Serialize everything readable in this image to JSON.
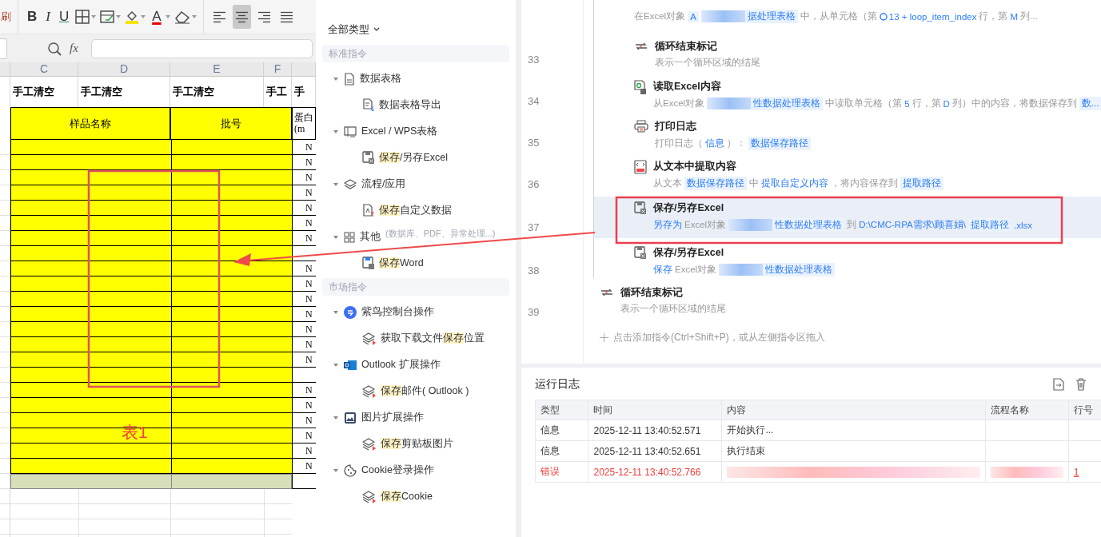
{
  "spreadsheet": {
    "toolbar": {
      "cut_label": "刷",
      "format_buttons": [
        "B",
        "I",
        "U"
      ],
      "font_color_label": "A",
      "align_buttons": [
        {
          "selected": false
        },
        {
          "selected": true
        },
        {
          "selected": false
        },
        {
          "selected": false
        }
      ]
    },
    "formula_label": "fx",
    "column_headers": [
      "C",
      "D",
      "E",
      "F"
    ],
    "header_row": [
      "手工清空",
      "手工清空",
      "手工清空",
      "手工",
      "手"
    ],
    "title_row": {
      "sample": "样品名称",
      "batch": "批号",
      "protein": "蛋白",
      "unit": "(m"
    },
    "rows": [
      {
        "column_g": "N"
      },
      {
        "column_g": "N"
      },
      {
        "column_g": "N"
      },
      {
        "column_g": "N"
      },
      {
        "column_g": "N"
      },
      {
        "column_g": "N"
      },
      {
        "column_g": "N"
      },
      {},
      {
        "column_g": "N"
      },
      {
        "column_g": "N"
      },
      {
        "column_g": "N"
      },
      {
        "column_g": "N"
      },
      {
        "column_g": "N"
      },
      {
        "column_g": "N"
      },
      {
        "column_g": "N"
      },
      {},
      {
        "column_g": "N"
      },
      {
        "column_g": "N"
      },
      {
        "column_g": "N"
      },
      {
        "column_g": "N"
      },
      {
        "column_g": "N"
      },
      {
        "column_g": "N"
      }
    ],
    "annotation_label": "表1"
  },
  "commands": {
    "filter": "全部类型",
    "sections": [
      {
        "title": "标准指令",
        "groups": [
          {
            "label": "数据表格",
            "expanded": true,
            "items": [
              {
                "parts": [
                  {
                    "text": "数据表格导出",
                    "highlight": false
                  }
                ]
              }
            ]
          },
          {
            "label": "Excel / WPS表格",
            "expanded": true,
            "items": [
              {
                "parts": [
                  {
                    "text": "保存",
                    "highlight": true
                  },
                  {
                    "text": "/另存Excel",
                    "highlight": false
                  }
                ]
              }
            ]
          },
          {
            "label": "流程/应用",
            "expanded": true,
            "items": [
              {
                "parts": [
                  {
                    "text": "保存",
                    "highlight": true
                  },
                  {
                    "text": "自定义数据",
                    "highlight": false
                  }
                ]
              }
            ]
          },
          {
            "label": "其他",
            "note": "(数据库、PDF、异常处理...)",
            "expanded": true,
            "items": [
              {
                "parts": [
                  {
                    "text": "保存",
                    "highlight": true
                  },
                  {
                    "text": "Word",
                    "highlight": false
                  }
                ]
              }
            ]
          }
        ]
      },
      {
        "title": "市场指令",
        "groups": [
          {
            "label": "紫鸟控制台操作",
            "expanded": true,
            "items": [
              {
                "parts": [
                  {
                    "text": "获取下载文件",
                    "highlight": false
                  },
                  {
                    "text": "保存",
                    "highlight": true
                  },
                  {
                    "text": "位置",
                    "highlight": false
                  }
                ]
              }
            ]
          },
          {
            "label": "Outlook 扩展操作",
            "expanded": true,
            "items": [
              {
                "parts": [
                  {
                    "text": "保存",
                    "highlight": true
                  },
                  {
                    "text": "邮件( Outlook )",
                    "highlight": false
                  }
                ]
              }
            ]
          },
          {
            "label": "图片扩展操作",
            "expanded": true,
            "items": [
              {
                "parts": [
                  {
                    "text": "保存",
                    "highlight": true
                  },
                  {
                    "text": "剪贴板图片",
                    "highlight": false
                  }
                ]
              }
            ]
          },
          {
            "label": "Cookie登录操作",
            "expanded": true,
            "items": [
              {
                "parts": [
                  {
                    "text": "保存",
                    "highlight": true
                  },
                  {
                    "text": "Cookie",
                    "highlight": false
                  }
                ]
              }
            ]
          }
        ]
      }
    ]
  },
  "flow": {
    "items": [
      {
        "kind": "loop-body",
        "children": [
          {
            "kind": "partial",
            "selected": false,
            "segments": [
              {
                "kind": "text",
                "text": "在Excel对象"
              },
              {
                "kind": "token",
                "text": "A"
              },
              {
                "kind": "redacted"
              },
              {
                "kind": "token",
                "text": "据处理表格"
              },
              {
                "kind": "text",
                "text": "中，从单元格（第"
              },
              {
                "kind": "variable",
                "text": "13 + loop_item_index"
              },
              {
                "kind": "text",
                "text": "行，第"
              },
              {
                "kind": "value",
                "text": "M"
              },
              {
                "kind": "text",
                "text": "列..."
              }
            ]
          },
          {
            "line": "33",
            "kind": "loop-end",
            "title": "循环结束标记",
            "selected": false,
            "segments": [
              {
                "kind": "text",
                "text": "表示一个循环区域的结尾"
              }
            ]
          },
          {
            "line": "34",
            "kind": "read-excel",
            "title": "读取Excel内容",
            "selected": false,
            "segments": [
              {
                "kind": "text",
                "text": "从Excel对象"
              },
              {
                "kind": "redacted"
              },
              {
                "kind": "token",
                "text": "性数据处理表格"
              },
              {
                "kind": "text",
                "text": "中读取单元格（第"
              },
              {
                "kind": "value",
                "text": "5"
              },
              {
                "kind": "text",
                "text": "行，第"
              },
              {
                "kind": "value",
                "text": "D"
              },
              {
                "kind": "text",
                "text": "列）中的内容，将数据保存到"
              },
              {
                "kind": "token",
                "text": "数..."
              }
            ]
          },
          {
            "line": "35",
            "kind": "print",
            "title": "打印日志",
            "selected": false,
            "segments": [
              {
                "kind": "text",
                "text": "打印日志（"
              },
              {
                "kind": "value",
                "text": "信息"
              },
              {
                "kind": "text",
                "text": "）："
              },
              {
                "kind": "token",
                "text": "数据保存路径"
              }
            ]
          },
          {
            "line": "36",
            "kind": "extract",
            "title": "从文本中提取内容",
            "selected": false,
            "segments": [
              {
                "kind": "text",
                "text": "从文本"
              },
              {
                "kind": "token",
                "text": "数据保存路径"
              },
              {
                "kind": "text",
                "text": "中"
              },
              {
                "kind": "value",
                "text": "提取自定义内容"
              },
              {
                "kind": "text",
                "text": "，将内容保存到"
              },
              {
                "kind": "token",
                "text": "提取路径"
              }
            ]
          },
          {
            "line": "37",
            "kind": "save-excel",
            "title": "保存/另存Excel",
            "selected": true,
            "segments": [
              {
                "kind": "value",
                "text": "另存为"
              },
              {
                "kind": "text",
                "text": "Excel对象"
              },
              {
                "kind": "redacted"
              },
              {
                "kind": "token",
                "text": "性数据处理表格"
              },
              {
                "kind": "text",
                "text": "到"
              },
              {
                "kind": "value",
                "text": "D:\\CMC-RPA需求\\顾喜娟\\"
              },
              {
                "kind": "token",
                "text": "提取路径"
              },
              {
                "kind": "value",
                "text": ".xlsx"
              }
            ]
          },
          {
            "line": "38",
            "kind": "save-excel",
            "title": "保存/另存Excel",
            "selected": false,
            "segments": [
              {
                "kind": "value",
                "text": "保存"
              },
              {
                "kind": "text",
                "text": "Excel对象"
              },
              {
                "kind": "redacted"
              },
              {
                "kind": "token",
                "text": "性数据处理表格"
              }
            ]
          }
        ]
      },
      {
        "kind": "loop-end",
        "line": "39",
        "title": "循环结束标记",
        "selected": false,
        "segments": [
          {
            "kind": "text",
            "text": "表示一个循环区域的结尾"
          }
        ]
      }
    ],
    "add_hint": "点击添加指令(Ctrl+Shift+P)，或从左侧指令区拖入"
  },
  "log": {
    "title": "运行日志",
    "columns": [
      "类型",
      "时间",
      "内容",
      "流程名称",
      "行号"
    ],
    "rows": [
      {
        "kind": "info",
        "type": "信息",
        "time": "2025-12-11 13:40:52.571",
        "content": "开始执行..."
      },
      {
        "kind": "info",
        "type": "信息",
        "time": "2025-12-11 13:40:52.651",
        "content": "执行结束"
      },
      {
        "kind": "error",
        "type": "错误",
        "time": "2025-12-11 13:40:52.766",
        "redacted": true,
        "line": "1"
      }
    ]
  }
}
